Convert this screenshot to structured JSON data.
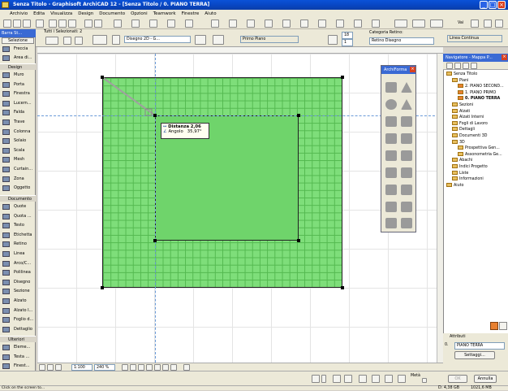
{
  "window": {
    "title": "Senza Titolo - Graphisoft ArchiCAD 12 - [Senza Titolo / 0. PIANO TERRA]",
    "min": "_",
    "max": "□",
    "close": "×"
  },
  "menu": [
    "Archivio",
    "Edita",
    "Visualizza",
    "Design",
    "Documento",
    "Opzioni",
    "Teamwork",
    "Finestre",
    "Aiuto"
  ],
  "toolbar2": {
    "selected": "Tutti i Selezionati: 2",
    "display_mode": "Disegno 2D - G...",
    "floor_label": "Primo Piano",
    "num1": "18",
    "num2": "1",
    "category_label": "Categoria Retino:",
    "category_value": "Retino Disegno",
    "line_value": "Linea Continua",
    "vai": "Vai"
  },
  "toolbox": {
    "header": "Barra St...",
    "selection": "Selezione",
    "items_top": [
      "Freccia",
      "Area di..."
    ],
    "section_design": "Design",
    "design_items": [
      "Muro",
      "Porta",
      "Finestra",
      "Lucern...",
      "Falda",
      "Trave",
      "Colonna",
      "Solaio",
      "Scala",
      "Mesh",
      "Curtain...",
      "Zona",
      "Oggetto"
    ],
    "section_doc": "Documento",
    "doc_items": [
      "Quote",
      "Quota ...",
      "Testo",
      "Etichetta",
      "Retino",
      "Linea",
      "Arco/C...",
      "Polilinea",
      "Disegno",
      "Sezione",
      "Alzato",
      "Alzato I...",
      "Foglio d...",
      "Dettaglio"
    ],
    "section_more": "Ulteriori",
    "more_items": [
      "Eleme...",
      "Testa ...",
      "Finest..."
    ]
  },
  "tooltip": {
    "distance_label": "Distanza",
    "distance_value": "2,06",
    "angle_label": "Angolo",
    "angle_value": "35,97°"
  },
  "palette": {
    "title": "ArchiForma"
  },
  "navigator": {
    "title": "Navigatore - Mappa P...",
    "tree": [
      {
        "label": "Senza Titolo",
        "level": 0
      },
      {
        "label": "Piani",
        "level": 1
      },
      {
        "label": "2. PIANO SECOND...",
        "level": 2
      },
      {
        "label": "1. PIANO PRIMO",
        "level": 2
      },
      {
        "label": "0. PIANO TERRA",
        "level": 2
      },
      {
        "label": "Sezioni",
        "level": 1
      },
      {
        "label": "Alzati",
        "level": 1
      },
      {
        "label": "Alzati Interni",
        "level": 1
      },
      {
        "label": "Fogli di Lavoro",
        "level": 1
      },
      {
        "label": "Dettagli",
        "level": 1
      },
      {
        "label": "Documenti 3D",
        "level": 1
      },
      {
        "label": "3D",
        "level": 1
      },
      {
        "label": "Prospettiva Gen...",
        "level": 2
      },
      {
        "label": "Assonometria Ge...",
        "level": 2
      },
      {
        "label": "Abachi",
        "level": 1
      },
      {
        "label": "Indici Progetto",
        "level": 1
      },
      {
        "label": "Liste",
        "level": 1
      },
      {
        "label": "Informazioni",
        "level": 1
      },
      {
        "label": "Aiuto",
        "level": 0
      }
    ],
    "attributes_label": "Attributi",
    "attr_id": "0.",
    "attr_value": "PIANO TERRA",
    "settings_button": "Settaggi..."
  },
  "bottom": {
    "scale": "1:100",
    "zoom": "240 %"
  },
  "footer": {
    "meta": "Metà",
    "ok": "OK",
    "cancel": "Annulla",
    "disk": "D: 4,38 GB",
    "mem": "1021,6 MB"
  },
  "status": "Click on the screen to...",
  "colors": {
    "title_blue": "#0a52d8",
    "fill_green": "#7ede7a",
    "grid_green": "#54b950"
  }
}
